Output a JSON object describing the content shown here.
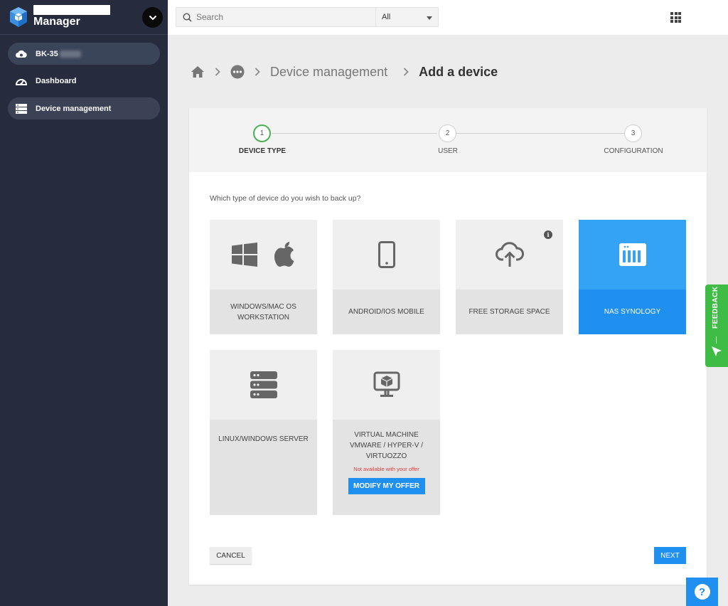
{
  "app": {
    "title": "Manager"
  },
  "sidebar": {
    "account_label": "BK-35",
    "items": [
      {
        "label": "Dashboard",
        "icon": "dashboard-icon"
      },
      {
        "label": "Device management",
        "icon": "server-icon",
        "active": true
      }
    ]
  },
  "topbar": {
    "search_placeholder": "Search",
    "scope_value": "All"
  },
  "breadcrumb": {
    "items": [
      "Device management"
    ],
    "current": "Add a device"
  },
  "stepper": {
    "steps": [
      {
        "number": "1",
        "label": "DEVICE TYPE",
        "active": true
      },
      {
        "number": "2",
        "label": "USER"
      },
      {
        "number": "3",
        "label": "CONFIGURATION"
      }
    ]
  },
  "wizard": {
    "question": "Which type of device do you wish to back up?",
    "tiles": [
      {
        "label": "WINDOWS/MAC OS WORKSTATION",
        "icon": "windows-apple-icon"
      },
      {
        "label": "ANDROID/IOS MOBILE",
        "icon": "mobile-icon"
      },
      {
        "label": "FREE STORAGE SPACE",
        "icon": "cloud-upload-icon",
        "info": "i"
      },
      {
        "label": "NAS SYNOLOGY",
        "icon": "nas-icon",
        "selected": true
      },
      {
        "label": "LINUX/WINDOWS SERVER",
        "icon": "server-stack-icon"
      },
      {
        "label": "VIRTUAL MACHINE VMWARE / HYPER-V / VIRTUOZZO",
        "icon": "virtual-machine-icon",
        "note": "Not available with your offer",
        "action": "MODIFY MY OFFER"
      }
    ],
    "cancel_label": "CANCEL",
    "next_label": "NEXT"
  },
  "feedback": {
    "label": "FEEDBACK"
  },
  "help": {
    "label": "?"
  },
  "colors": {
    "accent": "#1f8ff0",
    "selected_tile": "#34a2f5",
    "sidebar": "#262b3e",
    "step_active": "#4caf50",
    "feedback": "#3fbc45",
    "warning": "#e53935"
  }
}
